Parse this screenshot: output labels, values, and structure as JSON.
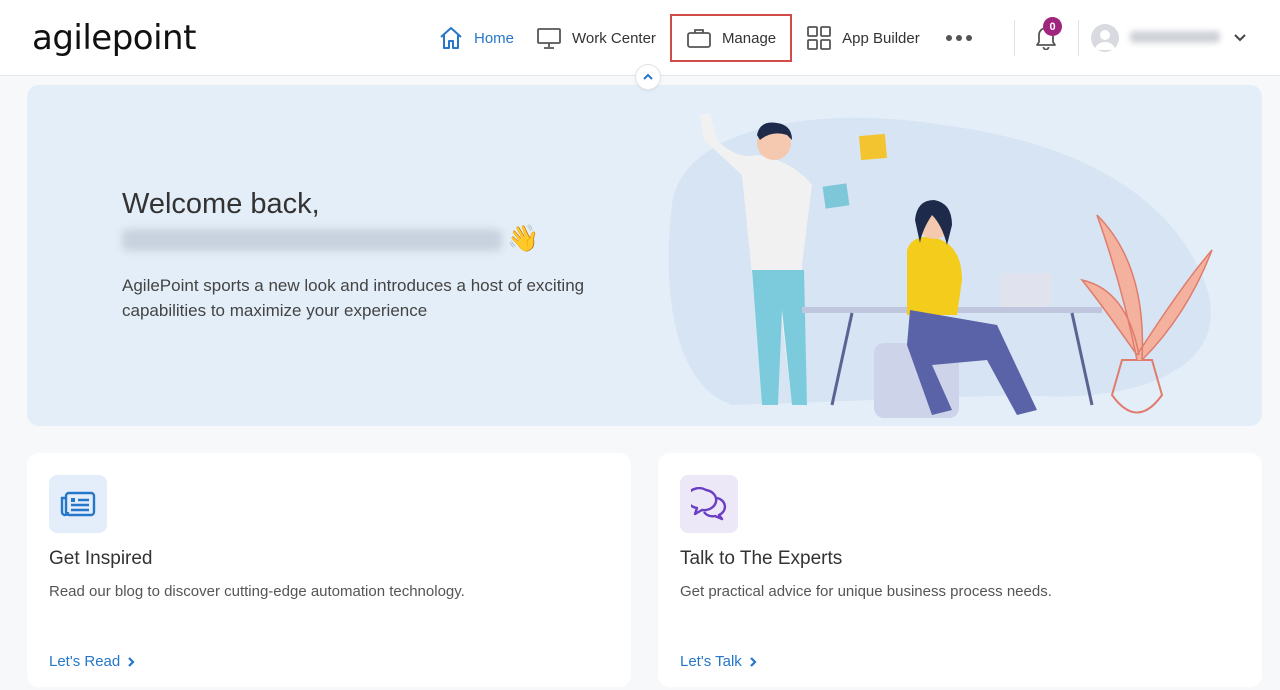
{
  "app": {
    "logo_text": "agilepoint"
  },
  "nav": {
    "items": [
      {
        "label": "Home",
        "icon": "home-icon",
        "active": true
      },
      {
        "label": "Work Center",
        "icon": "monitor-icon",
        "active": false
      },
      {
        "label": "Manage",
        "icon": "briefcase-icon",
        "active": false,
        "highlighted": true
      },
      {
        "label": "App Builder",
        "icon": "grid-icon",
        "active": false
      }
    ],
    "more_icon": "more-dots-icon"
  },
  "header": {
    "notification_count": "0",
    "username": "[blurred]"
  },
  "hero": {
    "title": "Welcome back,",
    "user_name": "[blurred]",
    "wave_emoji": "👋",
    "description": "AgilePoint sports a new look and introduces a host of exciting capabilities to maximize your experience"
  },
  "cards": [
    {
      "title": "Get Inspired",
      "description": "Read our blog to discover cutting-edge automation technology.",
      "link": "Let's Read",
      "icon": "newspaper-icon",
      "icon_bg": "#e3eefa",
      "icon_color": "#2677c9"
    },
    {
      "title": "Talk to The Experts",
      "description": "Get practical advice for unique business process needs.",
      "link": "Let's Talk",
      "icon": "chat-bubbles-icon",
      "icon_bg": "#ede8f8",
      "icon_color": "#6a3fc2"
    }
  ],
  "colors": {
    "accent": "#2677c9",
    "badge": "#a0267d",
    "highlight_border": "#d14b4b",
    "hero_bg": "#e4eef8"
  }
}
